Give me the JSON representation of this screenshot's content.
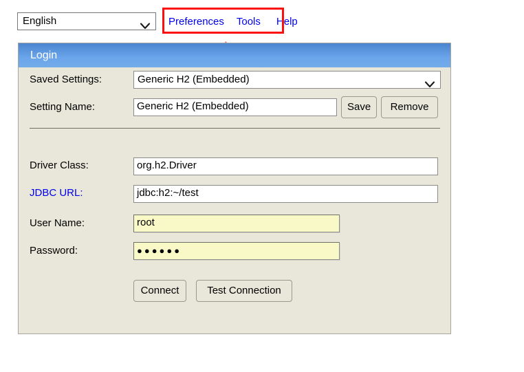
{
  "toolbar": {
    "language_select": {
      "value": "English",
      "icon": "chevron-down-icon"
    },
    "links": [
      {
        "id": "preferences",
        "label": "Preferences"
      },
      {
        "id": "tools",
        "label": "Tools"
      },
      {
        "id": "help",
        "label": "Help"
      }
    ],
    "highlight_color": "#fb0f0f"
  },
  "annotation": {
    "arrow_color": "#f83a32",
    "points_to": "Preferences / Tools menu"
  },
  "panel": {
    "title": "Login",
    "header_color_top": "#4a85d0",
    "header_color_bottom": "#74ace9",
    "body_color": "#e9e7d9",
    "fields": {
      "saved_settings": {
        "label": "Saved Settings:",
        "value": "Generic H2 (Embedded)",
        "icon": "chevron-down-icon"
      },
      "setting_name": {
        "label": "Setting Name:",
        "value": "Generic H2 (Embedded)"
      },
      "driver_class": {
        "label": "Driver Class:",
        "value": "org.h2.Driver"
      },
      "jdbc_url": {
        "label": "JDBC URL:",
        "value": "jdbc:h2:~/test",
        "label_color": "#0000ee"
      },
      "user_name": {
        "label": "User Name:",
        "value": "root",
        "field_color": "#f9f9c8"
      },
      "password": {
        "label": "Password:",
        "value": "●●●●●●",
        "field_color": "#f9f9c8"
      }
    },
    "buttons": {
      "save": "Save",
      "remove": "Remove",
      "connect": "Connect",
      "test_connection": "Test Connection"
    }
  }
}
